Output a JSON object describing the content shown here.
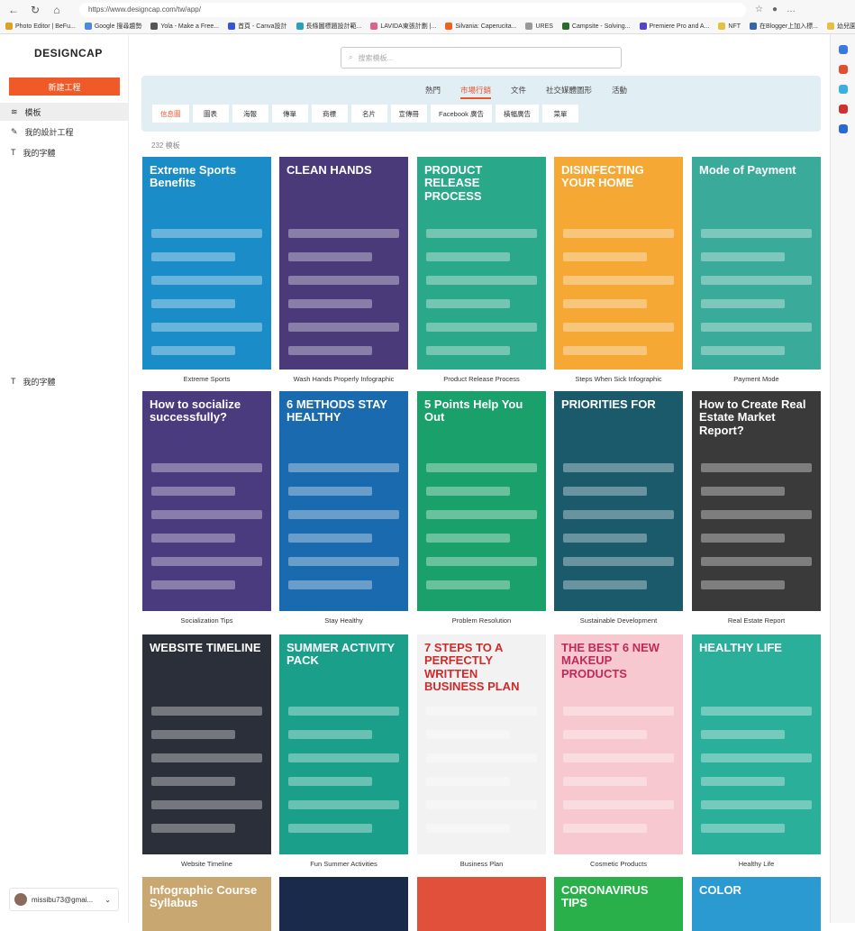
{
  "browser": {
    "url": "https://www.designcap.com/tw/app/",
    "bookmarks": [
      {
        "label": "Photo Editor | BeFu...",
        "color": "#e0a020"
      },
      {
        "label": "Google 搜尋趨勢",
        "color": "#4a8ae0"
      },
      {
        "label": "Yola - Make a Free...",
        "color": "#555"
      },
      {
        "label": "首頁 - Canva設計",
        "color": "#3355dd"
      },
      {
        "label": "長條圖標題設計範...",
        "color": "#2aa0c0"
      },
      {
        "label": "LAVIDA東張計劃 |...",
        "color": "#e06090"
      },
      {
        "label": "Silvania: Caperucita...",
        "color": "#f06020"
      },
      {
        "label": "URES",
        "color": "#999"
      },
      {
        "label": "Campsite - Solving...",
        "color": "#2a6a2a"
      },
      {
        "label": "Premiere Pro and A...",
        "color": "#5544cc"
      },
      {
        "label": "NFT",
        "color": "#e8c040"
      },
      {
        "label": "在Blogger上加入標...",
        "color": "#3366aa"
      },
      {
        "label": "幼兒園",
        "color": "#e8c040"
      },
      {
        "label": "其他 [我的最愛]",
        "color": "#e8c040"
      }
    ]
  },
  "sidebar": {
    "logo": "DESIGNCAP",
    "new_project": "新建工程",
    "items": [
      {
        "label": "模板",
        "icon": "layers-icon"
      },
      {
        "label": "我的設計工程",
        "icon": "edit-icon"
      },
      {
        "label": "我的字體",
        "icon": "text-icon"
      },
      {
        "label": "我的字體",
        "icon": "text-icon"
      }
    ],
    "account": "missibu73@gmai..."
  },
  "search": {
    "placeholder": "搜索模板..."
  },
  "tabs": [
    "熱門",
    "市場行銷",
    "文件",
    "社交媒體圖形",
    "活動"
  ],
  "active_tab": 1,
  "subtabs": [
    "信息圖",
    "圖表",
    "海報",
    "傳單",
    "商標",
    "名片",
    "宣傳冊",
    "Facebook 廣告",
    "橫幅廣告",
    "菜單"
  ],
  "active_subtab": 0,
  "count": "232 模板",
  "templates": [
    {
      "title": "Extreme Sports Benefits",
      "caption": "Extreme Sports",
      "bg": "#1a8cc8",
      "fg": "#fff"
    },
    {
      "title": "CLEAN HANDS",
      "caption": "Wash Hands Properly Infographic",
      "bg": "#4a3a7a",
      "fg": "#fff"
    },
    {
      "title": "PRODUCT RELEASE PROCESS",
      "caption": "Product Release Process",
      "bg": "#2aa88a",
      "fg": "#fff"
    },
    {
      "title": "DISINFECTING YOUR HOME",
      "caption": "Steps When Sick Infographic",
      "bg": "#f5a833",
      "fg": "#fff"
    },
    {
      "title": "Mode of Payment",
      "caption": "Payment Mode",
      "bg": "#3aaa9a",
      "fg": "#fff"
    },
    {
      "title": "How to socialize successfully?",
      "caption": "Socialization Tips",
      "bg": "#4a3a7e",
      "fg": "#fff"
    },
    {
      "title": "6 METHODS STAY HEALTHY",
      "caption": "Stay Healthy",
      "bg": "#1a6ab0",
      "fg": "#fff"
    },
    {
      "title": "5 Points Help You Out",
      "caption": "Problem Resolution",
      "bg": "#1aa06a",
      "fg": "#fff"
    },
    {
      "title": "PRIORITIES FOR",
      "caption": "Sustainable Development",
      "bg": "#1a5a6a",
      "fg": "#fff"
    },
    {
      "title": "How to Create Real Estate Market Report?",
      "caption": "Real Estate Report",
      "bg": "#3a3a3a",
      "fg": "#fff"
    },
    {
      "title": "WEBSITE TIMELINE",
      "caption": "Website Timeline",
      "bg": "#2a2f3a",
      "fg": "#fff"
    },
    {
      "title": "SUMMER ACTIVITY PACK",
      "caption": "Fun Summer Activities",
      "bg": "#1aa08a",
      "fg": "#fff"
    },
    {
      "title": "7 STEPS TO A PERFECTLY WRITTEN BUSINESS PLAN",
      "caption": "Business Plan",
      "bg": "#f2f2f2",
      "fg": "#d02a2a"
    },
    {
      "title": "THE BEST 6 NEW MAKEUP PRODUCTS",
      "caption": "Cosmetic Products",
      "bg": "#f7c8d0",
      "fg": "#c02a5a"
    },
    {
      "title": "HEALTHY LIFE",
      "caption": "Healthy Life",
      "bg": "#2ab09a",
      "fg": "#fff"
    },
    {
      "title": "Infographic Course Syllabus",
      "caption": "",
      "bg": "#c8a870",
      "fg": "#fff"
    },
    {
      "title": "",
      "caption": "",
      "bg": "#1a2a4a",
      "fg": "#fff"
    },
    {
      "title": "",
      "caption": "",
      "bg": "#e0503a",
      "fg": "#fff"
    },
    {
      "title": "CORONAVIRUS TIPS",
      "caption": "",
      "bg": "#2ab04a",
      "fg": "#fff"
    },
    {
      "title": "COLOR",
      "caption": "",
      "bg": "#2a9ad0",
      "fg": "#fff"
    }
  ]
}
